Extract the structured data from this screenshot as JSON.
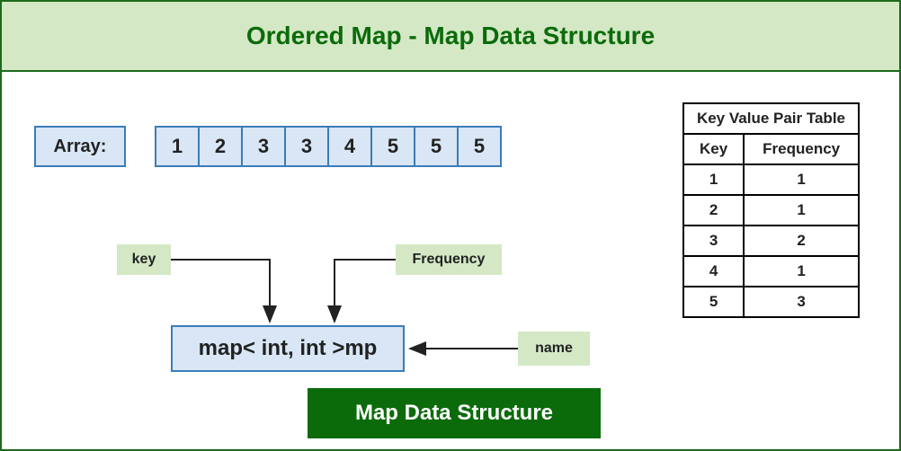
{
  "title": "Ordered Map - Map Data Structure",
  "array_label": "Array:",
  "array_values": [
    "1",
    "2",
    "3",
    "3",
    "4",
    "5",
    "5",
    "5"
  ],
  "tags": {
    "key": "key",
    "frequency": "Frequency",
    "name": "name"
  },
  "map_decl": "map< int, int >mp",
  "footer": "Map Data Structure",
  "table": {
    "title": "Key Value Pair Table",
    "col1": "Key",
    "col2": "Frequency",
    "rows": [
      {
        "k": "1",
        "v": "1"
      },
      {
        "k": "2",
        "v": "1"
      },
      {
        "k": "3",
        "v": "2"
      },
      {
        "k": "4",
        "v": "1"
      },
      {
        "k": "5",
        "v": "3"
      }
    ]
  }
}
